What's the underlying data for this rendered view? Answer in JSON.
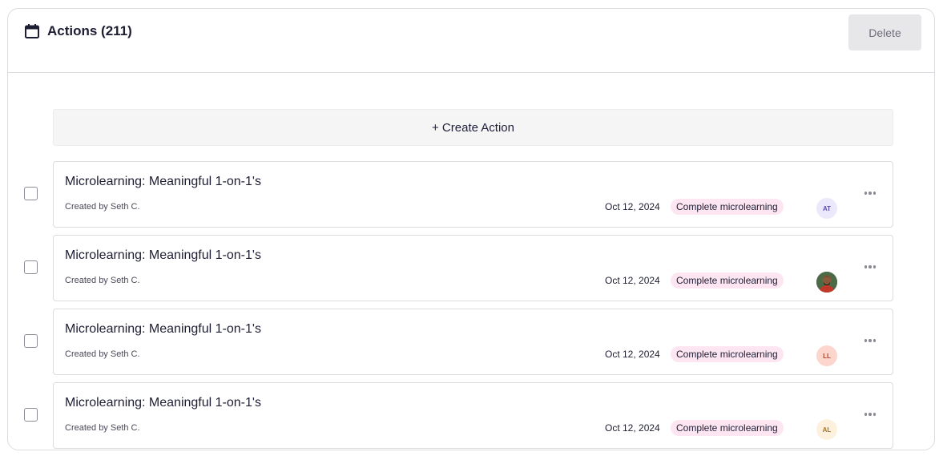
{
  "header": {
    "title": "Actions (211)",
    "delete_label": "Delete"
  },
  "create_action_label": "+ Create Action",
  "actions": [
    {
      "title": "Microlearning: Meaningful 1-on-1's",
      "created_by": "Created by Seth C.",
      "date": "Oct 12, 2024",
      "tag": "Complete microlearning",
      "avatar": {
        "type": "initials",
        "initials": "AT",
        "bg": "#ece8fb",
        "fg": "#5b4ca8"
      }
    },
    {
      "title": "Microlearning: Meaningful 1-on-1's",
      "created_by": "Created by Seth C.",
      "date": "Oct 12, 2024",
      "tag": "Complete microlearning",
      "avatar": {
        "type": "photo",
        "initials": "",
        "bg": "#3c5a3a",
        "fg": "#ffffff"
      }
    },
    {
      "title": "Microlearning: Meaningful 1-on-1's",
      "created_by": "Created by Seth C.",
      "date": "Oct 12, 2024",
      "tag": "Complete microlearning",
      "avatar": {
        "type": "initials",
        "initials": "LL",
        "bg": "#fcd5cc",
        "fg": "#b2462e"
      }
    },
    {
      "title": "Microlearning: Meaningful 1-on-1's",
      "created_by": "Created by Seth C.",
      "date": "Oct 12, 2024",
      "tag": "Complete microlearning",
      "avatar": {
        "type": "initials",
        "initials": "AL",
        "bg": "#fdf1dd",
        "fg": "#a8742a"
      }
    }
  ],
  "colors": {
    "tag_bg": "#fde6f1",
    "border": "#dcdce0",
    "delete_bg": "#e7e7ea"
  }
}
